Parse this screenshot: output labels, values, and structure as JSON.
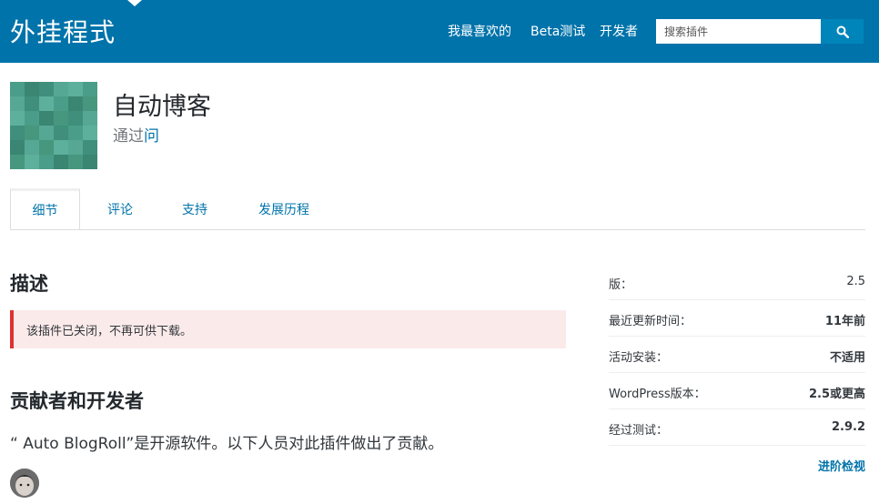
{
  "header": {
    "brand": "外挂程式",
    "nav": [
      "我最喜欢的",
      "Beta测试",
      "开发者"
    ],
    "search_placeholder": "搜索插件",
    "search_icon": "search-icon",
    "bar_color": "#0073aa"
  },
  "plugin": {
    "title": "自动博客",
    "author_prefix": "通过",
    "author_link": "问",
    "icon": "pixel-pattern-icon"
  },
  "tabs": [
    "细节",
    "评论",
    "支持",
    "发展历程"
  ],
  "active_tab": "细节",
  "description": {
    "heading": "描述",
    "notice": "该插件已关闭，不再可供下载。",
    "notice_color": "#dc3232"
  },
  "contributors": {
    "heading": "贡献者和开发者",
    "text": "“ Auto BlogRoll”是开源软件。以下人员对此插件做出了贡献。"
  },
  "meta": [
    {
      "label": "版：",
      "value": "2.5"
    },
    {
      "label": "最近更新时间：",
      "value": "11年前"
    },
    {
      "label": "活动安装：",
      "value": "不适用"
    },
    {
      "label": "WordPress版本：",
      "value": "2.5或更高"
    },
    {
      "label": "经过测试：",
      "value": "2.9.2"
    }
  ],
  "advanced_link": "进阶检视"
}
